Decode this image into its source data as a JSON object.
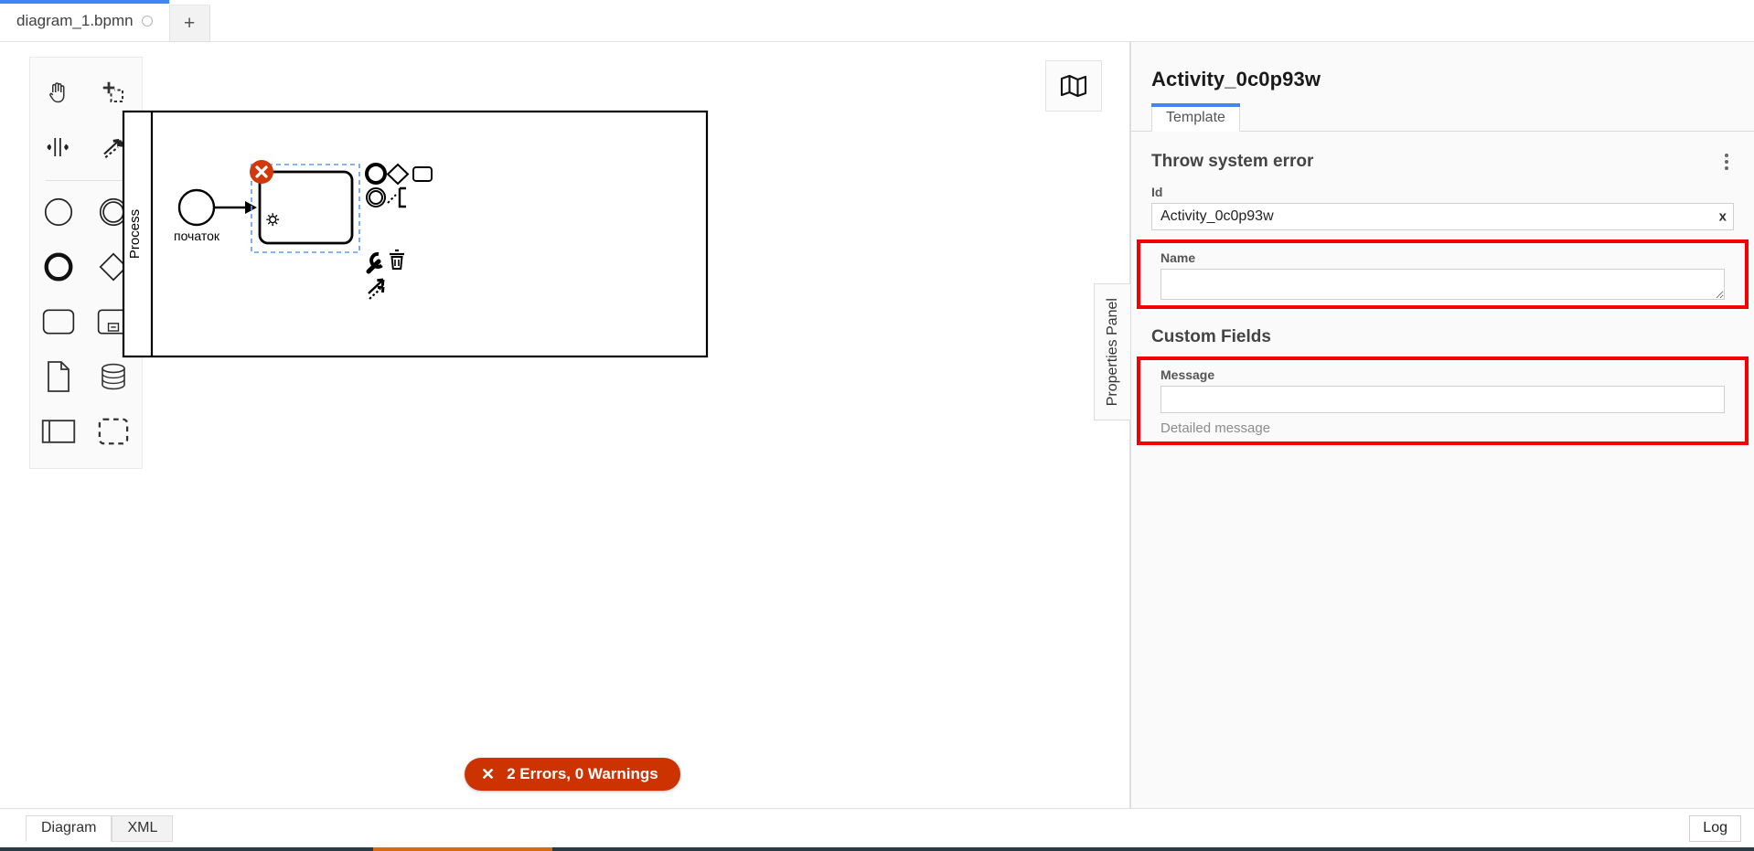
{
  "window": {
    "tabs": [
      {
        "label": "diagram_1.bpmn",
        "dirty": true,
        "active": true
      }
    ],
    "add_tab_label": "+"
  },
  "palette": {
    "tools": [
      {
        "name": "hand-tool",
        "title": "Activate the hand tool"
      },
      {
        "name": "lasso-tool",
        "title": "Activate the lasso tool"
      },
      {
        "name": "space-tool",
        "title": "Activate the create/remove space tool"
      },
      {
        "name": "connect-tool",
        "title": "Activate the global connect tool"
      },
      {
        "name": "start-event",
        "title": "Create StartEvent"
      },
      {
        "name": "intermediate-event",
        "title": "Create Intermediate/Boundary Event"
      },
      {
        "name": "end-event",
        "title": "Create EndEvent"
      },
      {
        "name": "gateway",
        "title": "Create Gateway"
      },
      {
        "name": "task",
        "title": "Create Task"
      },
      {
        "name": "subprocess-collapsed",
        "title": "Create collapsed Sub Process"
      },
      {
        "name": "data-object",
        "title": "Create DataObjectReference"
      },
      {
        "name": "data-store",
        "title": "Create DataStoreReference"
      },
      {
        "name": "participant",
        "title": "Create Pool/Participant"
      },
      {
        "name": "group",
        "title": "Create Group"
      }
    ]
  },
  "canvas": {
    "minimap_icon": "map-icon",
    "pool": {
      "label": "Process"
    },
    "start_event": {
      "label": "початок"
    },
    "task": {
      "label": "",
      "marker": "service-task-gear",
      "selected": true,
      "error": true
    },
    "context_pad": [
      {
        "name": "append-end-event",
        "icon": "end-event-icon"
      },
      {
        "name": "append-gateway",
        "icon": "gateway-icon"
      },
      {
        "name": "append-task",
        "icon": "task-icon"
      },
      {
        "name": "append-intermediate-event",
        "icon": "intermediate-event-icon"
      },
      {
        "name": "append-text-annotation",
        "icon": "text-annotation-icon"
      },
      {
        "name": "change-type",
        "icon": "wrench-icon"
      },
      {
        "name": "delete",
        "icon": "trash-icon"
      },
      {
        "name": "connect",
        "icon": "connect-icon"
      }
    ],
    "error_badge": {
      "icon": "x-icon",
      "label": "2 Errors, 0 Warnings"
    }
  },
  "properties_panel_tab": {
    "label": "Properties Panel"
  },
  "properties": {
    "title": "Activity_0c0p93w",
    "tabs": [
      {
        "label": "Template",
        "active": true
      }
    ],
    "template_group": {
      "heading": "Throw system error",
      "menu_icon": "kebab-menu-icon",
      "fields": [
        {
          "key": "id",
          "label": "Id",
          "value": "Activity_0c0p93w",
          "clear_icon": "x",
          "highlighted": false
        },
        {
          "key": "name",
          "label": "Name",
          "value": "",
          "highlighted": true
        }
      ]
    },
    "custom_fields": {
      "heading": "Custom Fields",
      "fields": [
        {
          "key": "message",
          "label": "Message",
          "value": "",
          "hint": "Detailed message",
          "highlighted": true
        }
      ]
    }
  },
  "bottom": {
    "tabs": [
      {
        "label": "Diagram",
        "active": true
      },
      {
        "label": "XML",
        "active": false
      }
    ],
    "log_label": "Log"
  },
  "colors": {
    "accent": "#4285f4",
    "error": "#cc3300",
    "annotation": "#f40000",
    "selection": "#5b9bf8"
  }
}
